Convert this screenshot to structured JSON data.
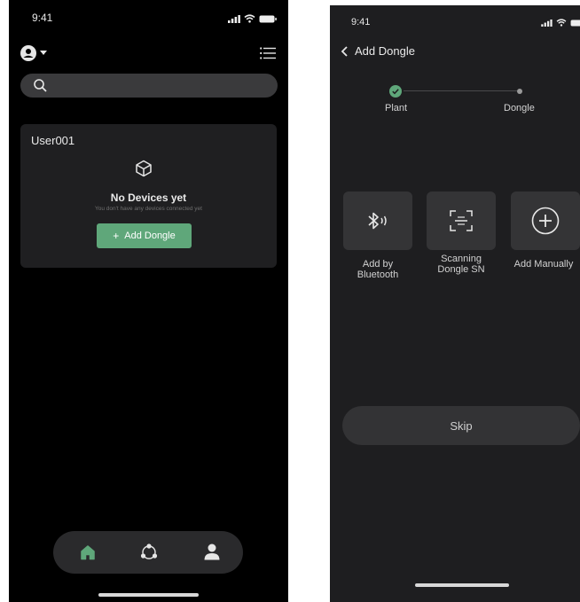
{
  "left": {
    "status_time": "9:41",
    "card": {
      "user_name": "User001",
      "empty_title": "No Devices yet",
      "empty_subtitle": "You don't have any devices connected yet",
      "add_button_label": "Add Dongle"
    },
    "nav": {
      "items": [
        "home-icon",
        "network-icon",
        "user-icon"
      ],
      "active_color": "#5fa77a"
    },
    "colors": {
      "accent": "#5fa77a"
    }
  },
  "right": {
    "status_time": "9:41",
    "header_title": "Add Dongle",
    "steps": [
      {
        "label": "Plant",
        "status": "done"
      },
      {
        "label": "Dongle",
        "status": "current"
      }
    ],
    "options": [
      {
        "label": "Add by\nBluetooth",
        "icon": "bluetooth-icon"
      },
      {
        "label": "Scanning\nDongle SN",
        "icon": "scan-icon"
      },
      {
        "label": "Add Manually",
        "icon": "plus-circle-icon"
      }
    ],
    "skip_label": "Skip"
  }
}
